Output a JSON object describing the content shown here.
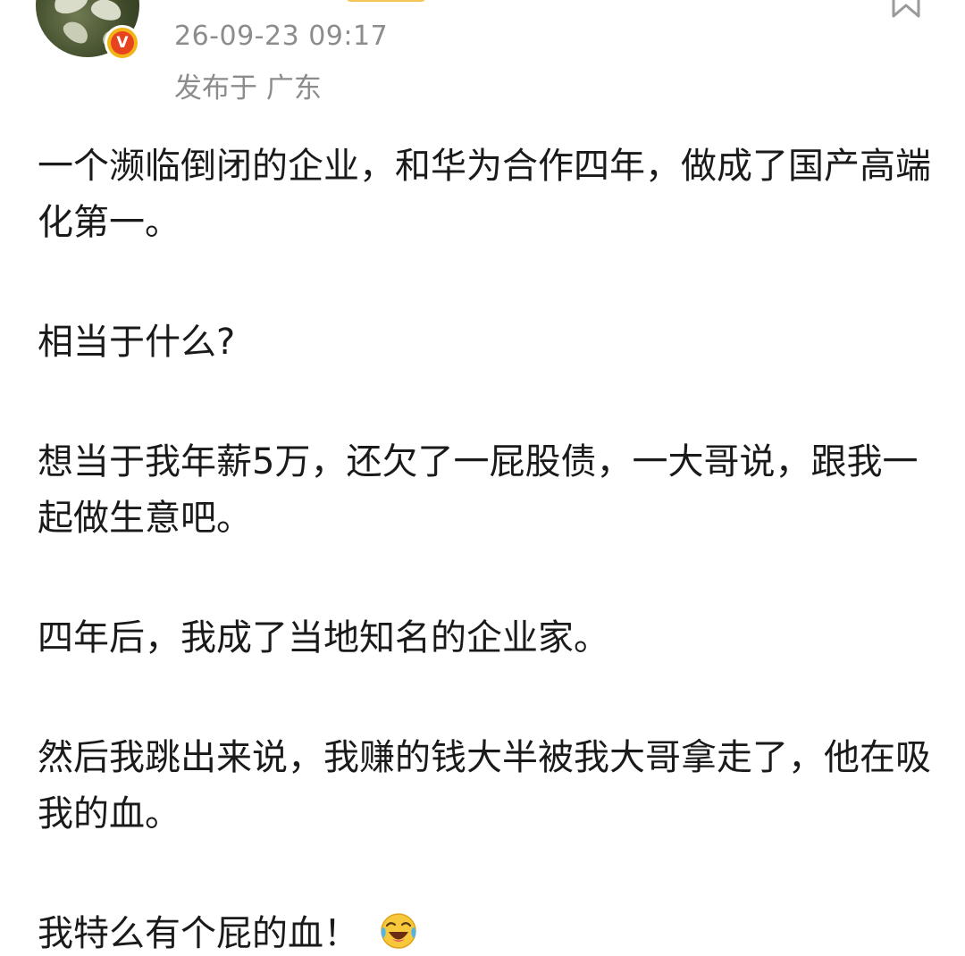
{
  "header": {
    "post_time": "26-09-23 09:17",
    "post_location": "发布于 广东",
    "verified_badge_letter": "V",
    "icons": {
      "avatar": "user-avatar",
      "verified": "verified-icon",
      "bookmark": "bookmark-icon"
    }
  },
  "post": {
    "paragraphs": [
      "一个濒临倒闭的企业，和华为合作四年，做成了国产高端化第一。",
      "相当于什么?",
      "想当于我年薪5万，还欠了一屁股债，一大哥说，跟我一起做生意吧。",
      "四年后，我成了当地知名的企业家。",
      "然后我跳出来说，我赚的钱大半被我大哥拿走了，他在吸我的血。",
      "我特么有个屁的血！"
    ],
    "trailing_emoji": "laughing-crying-emoji"
  },
  "colors": {
    "badge_gold": "#f2b417",
    "badge_red": "#e8431f",
    "meta_gray": "#8c8c8c",
    "text": "#1a1a1a"
  }
}
